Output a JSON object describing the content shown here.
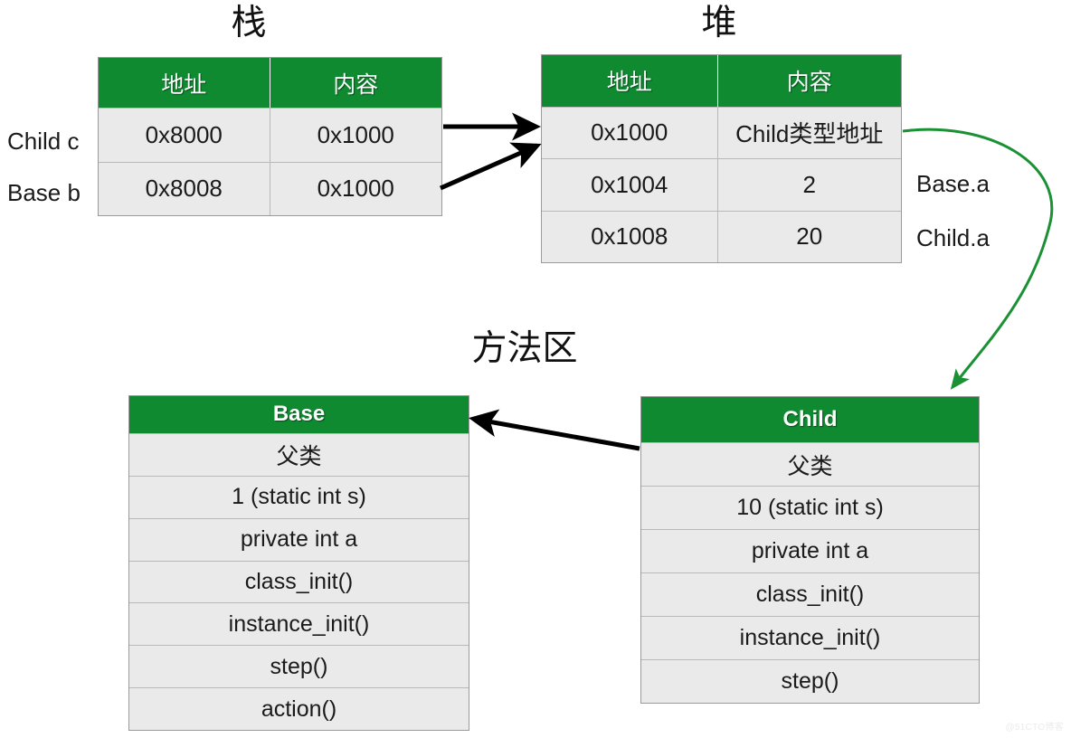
{
  "titles": {
    "stack": "栈",
    "heap": "堆",
    "method_area": "方法区"
  },
  "stack": {
    "headers": [
      "地址",
      "内容"
    ],
    "rows": [
      {
        "address": "0x8000",
        "content": "0x1000",
        "label": "Child c"
      },
      {
        "address": "0x8008",
        "content": "0x1000",
        "label": "Base b"
      }
    ]
  },
  "heap": {
    "headers": [
      "地址",
      "内容"
    ],
    "rows": [
      {
        "address": "0x1000",
        "content": "Child类型地址",
        "label": ""
      },
      {
        "address": "0x1004",
        "content": "2",
        "label": "Base.a"
      },
      {
        "address": "0x1008",
        "content": "20",
        "label": "Child.a"
      }
    ]
  },
  "method_area": {
    "base_class": {
      "name": "Base",
      "rows": [
        "父类",
        "1 (static int s)",
        "private int a",
        "class_init()",
        "instance_init()",
        "step()",
        "action()"
      ]
    },
    "child_class": {
      "name": "Child",
      "rows": [
        "父类",
        "10 (static int s)",
        "private int a",
        "class_init()",
        "instance_init()",
        "step()"
      ]
    }
  },
  "arrows": [
    {
      "name": "stack-child-c-to-heap",
      "color": "#000000"
    },
    {
      "name": "stack-base-b-to-heap",
      "color": "#000000"
    },
    {
      "name": "child-class-to-base-class",
      "color": "#000000"
    },
    {
      "name": "heap-object-to-child-class",
      "color": "#1a9134"
    }
  ],
  "colors": {
    "header_green": "#0f8a30",
    "cell_gray": "#eaeaea",
    "border_gray": "#9a9a9a",
    "row_divider": "#b9b9b9",
    "arrow_black": "#000000",
    "arrow_green": "#1a9134"
  },
  "watermark": "@51CTO博客"
}
